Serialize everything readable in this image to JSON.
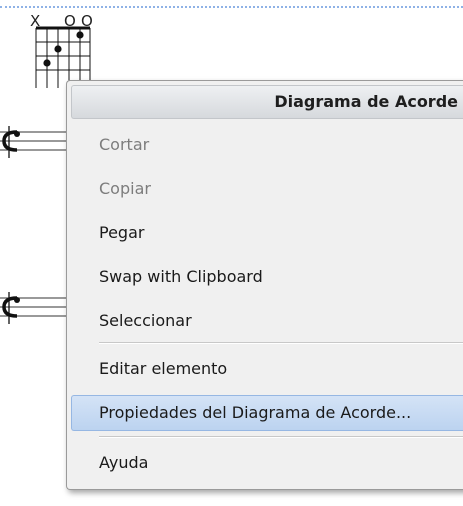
{
  "score": {
    "chord_diagram": {
      "string_markers": [
        "X",
        "O",
        "O"
      ],
      "strings": 6,
      "frets": 4
    }
  },
  "context_menu": {
    "header": "Diagrama de Acorde",
    "items": [
      {
        "label": "Cortar",
        "enabled": false
      },
      {
        "label": "Copiar",
        "enabled": false
      },
      {
        "label": "Pegar",
        "enabled": true
      },
      {
        "label": "Swap with Clipboard",
        "enabled": true
      },
      {
        "label": "Seleccionar",
        "enabled": true
      },
      {
        "label": "Editar elemento",
        "enabled": true
      },
      {
        "label": "Propiedades del Diagrama de Acorde...",
        "enabled": true,
        "highlighted": true
      },
      {
        "label": "Ayuda",
        "enabled": true
      }
    ]
  },
  "colors": {
    "highlight": "#bcd3f0",
    "selection_dotted": "#8fb2e6",
    "disabled_text": "#7d7d7d"
  }
}
